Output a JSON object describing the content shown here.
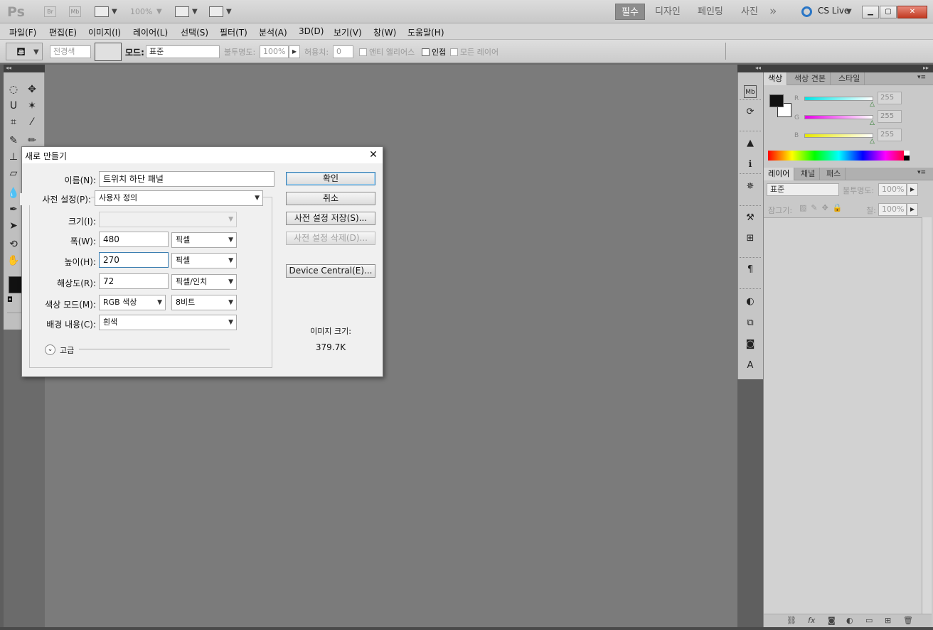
{
  "app": {
    "logo": "Ps",
    "mini_apps": [
      "Br",
      "Mb"
    ],
    "zoom": "100%",
    "workspaces": [
      "필수",
      "디자인",
      "페인팅",
      "사진"
    ],
    "active_workspace": "필수",
    "more": "»",
    "cs_live": "CS Live",
    "window_buttons": {
      "minimize": "▁",
      "maximize": "▢",
      "close": "✕"
    }
  },
  "menu": [
    "파일(F)",
    "편집(E)",
    "이미지(I)",
    "레이어(L)",
    "선택(S)",
    "필터(T)",
    "분석(A)",
    "3D(D)",
    "보기(V)",
    "창(W)",
    "도움말(H)"
  ],
  "options": {
    "fill_source": "전경색",
    "mode_label": "모드:",
    "mode_value": "표준",
    "opacity_label": "불투명도:",
    "opacity_value": "100%",
    "tolerance_label": "허용치:",
    "tolerance_value": "0",
    "antialias_label": "앤티 앨리어스",
    "contiguous_label": "인접",
    "all_layers_label": "모든 레이어"
  },
  "toolbar": {
    "collapse": "◂◂",
    "tools": [
      {
        "name": "marquee-tool-icon",
        "glyph": "◌"
      },
      {
        "name": "move-tool-icon",
        "glyph": "✥"
      },
      {
        "name": "lasso-tool-icon",
        "glyph": "ᑌ"
      },
      {
        "name": "magic-wand-tool-icon",
        "glyph": "✶"
      },
      {
        "name": "crop-tool-icon",
        "glyph": "⌗"
      },
      {
        "name": "eyedropper-tool-icon",
        "glyph": "⁄"
      },
      {
        "name": "healing-brush-tool-icon",
        "glyph": "✎"
      },
      {
        "name": "brush-tool-icon",
        "glyph": "✏"
      },
      {
        "name": "stamp-tool-icon",
        "glyph": "⊥"
      },
      {
        "name": "history-brush-tool-icon",
        "glyph": "↶"
      },
      {
        "name": "eraser-tool-icon",
        "glyph": "▱"
      },
      {
        "name": "gradient-tool-icon",
        "glyph": "▬"
      },
      {
        "name": "blur-tool-icon",
        "glyph": "💧"
      },
      {
        "name": "dodge-tool-icon",
        "glyph": "●"
      },
      {
        "name": "pen-tool-icon",
        "glyph": "✒"
      },
      {
        "name": "type-tool-icon",
        "glyph": "T"
      },
      {
        "name": "path-select-tool-icon",
        "glyph": "➤"
      },
      {
        "name": "shape-tool-icon",
        "glyph": "▭"
      },
      {
        "name": "rotate-view-tool-icon",
        "glyph": "⟲"
      },
      {
        "name": "zoom-tool-icon",
        "glyph": "🔍"
      },
      {
        "name": "hand-tool-icon",
        "glyph": "✋"
      },
      {
        "name": "zoom-tool-2-icon",
        "glyph": "⚲"
      }
    ]
  },
  "dock": {
    "collapse": "◂◂",
    "icons": [
      {
        "name": "mini-bridge-icon",
        "glyph": "Mb"
      },
      {
        "name": "history-icon",
        "glyph": "⟳"
      },
      {
        "name": "histogram-icon",
        "glyph": "▲"
      },
      {
        "name": "info-icon",
        "glyph": "ℹ"
      },
      {
        "name": "navigator-icon",
        "glyph": "✵"
      },
      {
        "name": "tool-presets-icon",
        "glyph": "⚒"
      },
      {
        "name": "clone-source-icon",
        "glyph": "⊞"
      },
      {
        "name": "paragraph-icon",
        "glyph": "¶"
      },
      {
        "name": "adjustments-icon",
        "glyph": "◐"
      },
      {
        "name": "masks-icon",
        "glyph": "⧉"
      },
      {
        "name": "camera-icon",
        "glyph": "◙"
      },
      {
        "name": "character-icon",
        "glyph": "A"
      }
    ]
  },
  "color_panel": {
    "menu": "▾≡",
    "tabs": [
      "색상",
      "색상 견본",
      "스타일"
    ],
    "active_tab": "색상",
    "channels": [
      {
        "label": "R",
        "value": "255",
        "color": "#00e5e5"
      },
      {
        "label": "G",
        "value": "255",
        "color": "#e800e8"
      },
      {
        "label": "B",
        "value": "255",
        "color": "#e8e800"
      }
    ],
    "foreground": "#111111",
    "background": "#ffffff"
  },
  "layers_panel": {
    "menu": "▾≡",
    "tabs": [
      "레이어",
      "채널",
      "패스"
    ],
    "active_tab": "레이어",
    "blend_mode": "표준",
    "opacity_label": "불투명도:",
    "opacity_value": "100%",
    "lock_label": "잠그기:",
    "fill_label": "칠:",
    "fill_value": "100%",
    "footer_icons": [
      "⛓",
      "fx",
      "◙",
      "◐",
      "▭",
      "⊞",
      "🗑"
    ]
  },
  "dialog": {
    "title": "새로 만들기",
    "close": "✕",
    "name_label": "이름(N):",
    "name_value": "트위치 하단 패널",
    "preset_label": "사전 설정(P):",
    "preset_value": "사용자 정의",
    "size_label": "크기(I):",
    "width_label": "폭(W):",
    "width_value": "480",
    "width_unit": "픽셀",
    "height_label": "높이(H):",
    "height_value": "270",
    "height_unit": "픽셀",
    "resolution_label": "해상도(R):",
    "resolution_value": "72",
    "resolution_unit": "픽셀/인치",
    "color_mode_label": "색상 모드(M):",
    "color_mode_value": "RGB 색상",
    "bit_depth_value": "8비트",
    "background_label": "배경 내용(C):",
    "background_value": "흰색",
    "advanced_label": "고급",
    "buttons": {
      "ok": "확인",
      "cancel": "취소",
      "save_preset": "사전 설정 저장(S)...",
      "delete_preset": "사전 설정 삭제(D)...",
      "device_central": "Device Central(E)..."
    },
    "image_size_label": "이미지 크기:",
    "image_size_value": "379.7K"
  }
}
